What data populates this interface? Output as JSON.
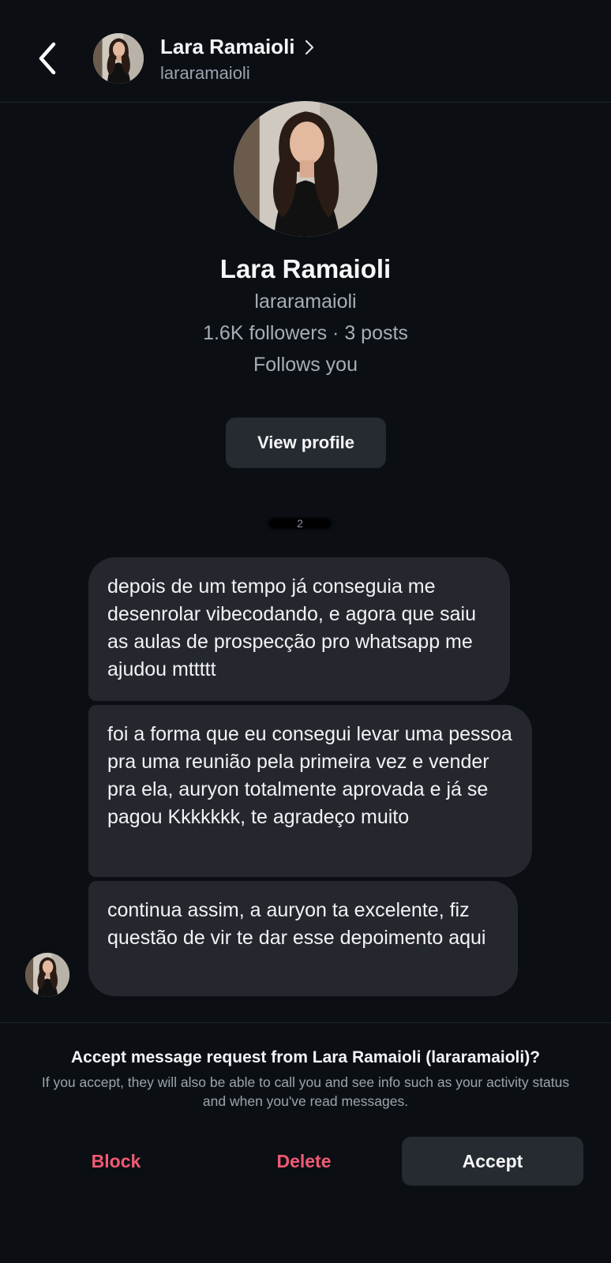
{
  "header": {
    "back_icon": "chevron-left-icon",
    "name": "Lara Ramaioli",
    "username": "lararamaioli",
    "chevron_icon": "chevron-right-icon"
  },
  "profile": {
    "name": "Lara Ramaioli",
    "username": "lararamaioli",
    "stats": "1.6K followers · 3 posts",
    "follows_you": "Follows you",
    "view_profile_label": "View profile"
  },
  "conversation": {
    "timestamp": "2",
    "messages": [
      {
        "text": "depois de um tempo já conseguia me desenrolar vibecodando, e agora que saiu as aulas de prospecção pro whatsapp me ajudou mttttt"
      },
      {
        "text": "foi a forma que eu consegui levar uma pessoa pra uma reunião pela primeira vez e vender pra ela, auryon totalmente aprovada e já se pagou Kkkkkkk, te agradeço muito"
      },
      {
        "text": "continua assim, a auryon ta excelente, fiz questão de vir te dar esse depoimento aqui"
      }
    ]
  },
  "request": {
    "title": "Accept message request from Lara Ramaioli (lararamaioli)?",
    "description": "If you accept, they will also be able to call you and see info such as your activity status and when you've read messages.",
    "block_label": "Block",
    "delete_label": "Delete",
    "accept_label": "Accept"
  },
  "colors": {
    "background": "#0b0f14",
    "bubble": "#24282e",
    "button": "#262b31",
    "danger": "#f05a74",
    "secondary_text": "#a6aeb7"
  }
}
